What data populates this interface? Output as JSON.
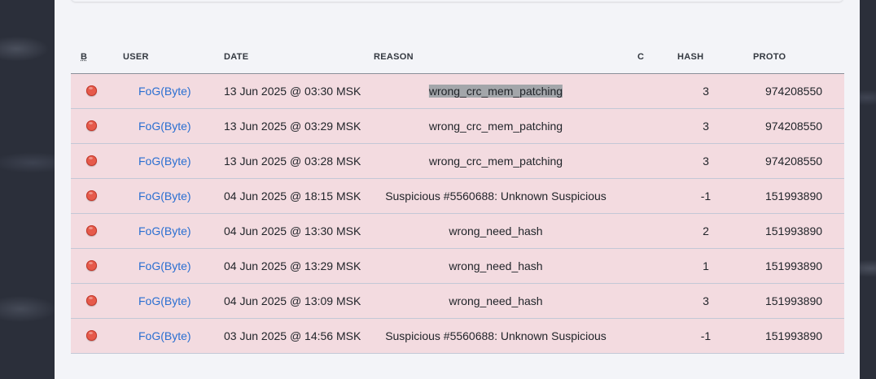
{
  "headers": {
    "b": "B",
    "user": "USER",
    "date": "DATE",
    "reason": "REASON",
    "c": "C",
    "hash": "HASH",
    "proto": "PROTO"
  },
  "status_color": "#e65a4b",
  "rows": [
    {
      "user": "FoG(Byte)",
      "date": "13 Jun 2025 @ 03:30 MSK",
      "reason": "wrong_crc_mem_patching",
      "hash": "3",
      "proto": "974208550"
    },
    {
      "user": "FoG(Byte)",
      "date": "13 Jun 2025 @ 03:29 MSK",
      "reason": "wrong_crc_mem_patching",
      "hash": "3",
      "proto": "974208550"
    },
    {
      "user": "FoG(Byte)",
      "date": "13 Jun 2025 @ 03:28 MSK",
      "reason": "wrong_crc_mem_patching",
      "hash": "3",
      "proto": "974208550"
    },
    {
      "user": "FoG(Byte)",
      "date": "04 Jun 2025 @ 18:15 MSK",
      "reason": "Suspicious #5560688: Unknown Suspicious",
      "hash": "-1",
      "proto": "151993890"
    },
    {
      "user": "FoG(Byte)",
      "date": "04 Jun 2025 @ 13:30 MSK",
      "reason": "wrong_need_hash",
      "hash": "2",
      "proto": "151993890"
    },
    {
      "user": "FoG(Byte)",
      "date": "04 Jun 2025 @ 13:29 MSK",
      "reason": "wrong_need_hash",
      "hash": "1",
      "proto": "151993890"
    },
    {
      "user": "FoG(Byte)",
      "date": "04 Jun 2025 @ 13:09 MSK",
      "reason": "wrong_need_hash",
      "hash": "3",
      "proto": "151993890"
    },
    {
      "user": "FoG(Byte)",
      "date": "03 Jun 2025 @ 14:56 MSK",
      "reason": "Suspicious #5560688: Unknown Suspicious",
      "hash": "-1",
      "proto": "151993890"
    }
  ]
}
